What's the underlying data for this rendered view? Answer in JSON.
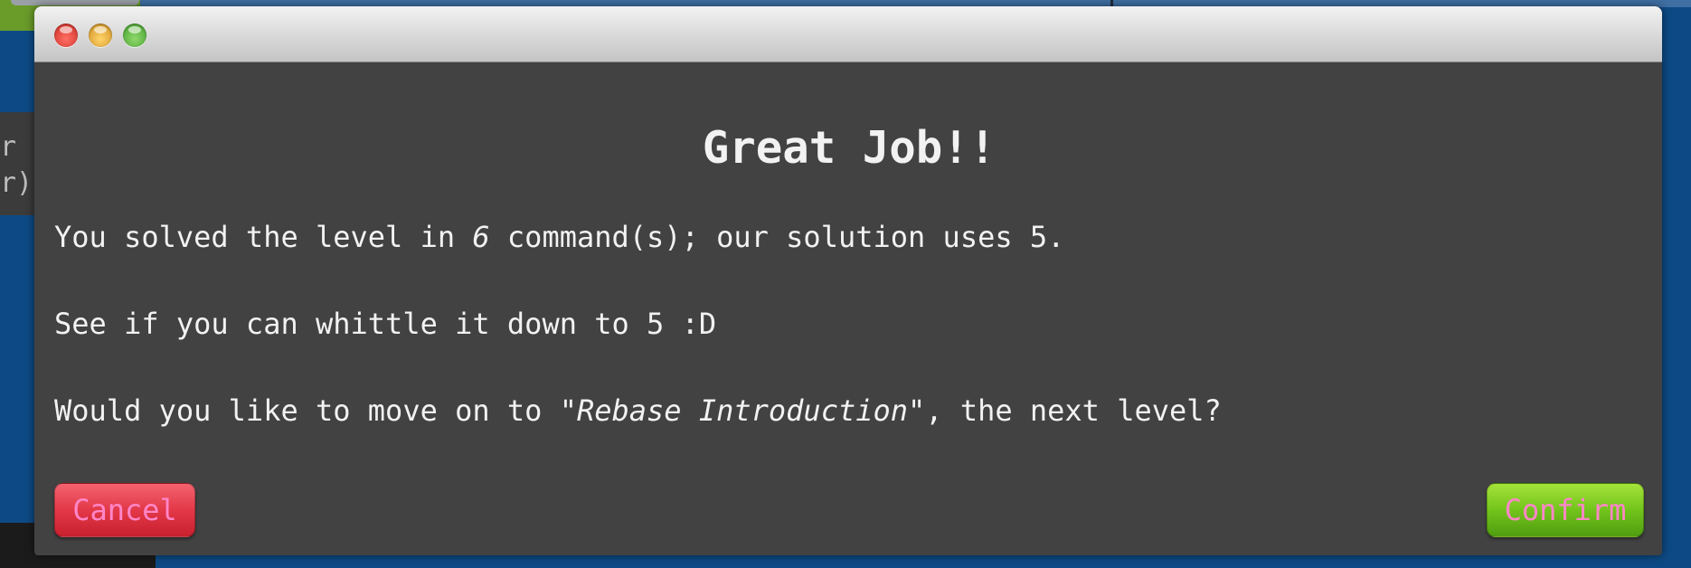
{
  "dialog": {
    "heading": "Great Job!!",
    "line1": {
      "before": "You solved the level in ",
      "count": "6",
      "after": " command(s); our solution uses 5."
    },
    "line2": "See if you can whittle it down to 5 :D",
    "line3": {
      "before": "Would you like to move on to ",
      "level_name": "\"Rebase Introduction\"",
      "after": ", the next level?"
    },
    "cancel_label": "Cancel",
    "confirm_label": "Confirm"
  },
  "background": {
    "panel_line1": "r",
    "panel_line2": "r)"
  },
  "colors": {
    "window_bg": "#424242",
    "cancel": "#e33848",
    "confirm": "#72c41c",
    "button_text": "#ff86c8"
  }
}
